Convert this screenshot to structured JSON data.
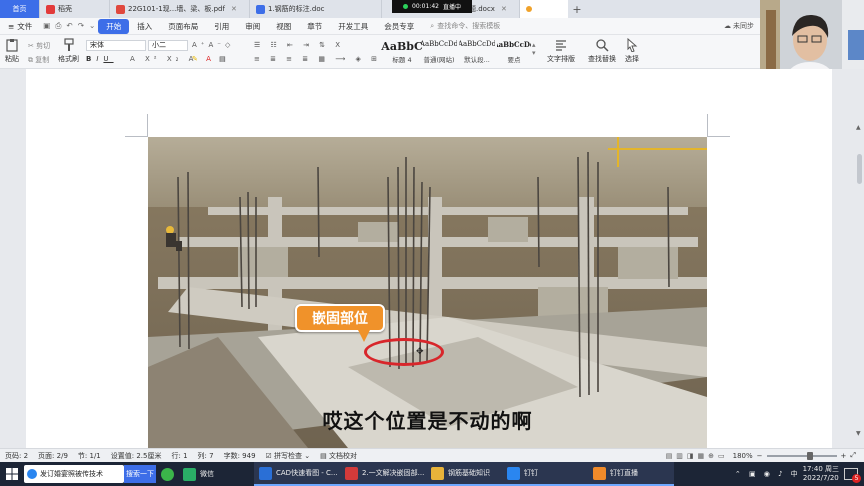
{
  "tabs": [
    {
      "label": "首页",
      "kind": "home"
    },
    {
      "label": "稻壳",
      "kind": "app"
    },
    {
      "label": "22G101-1现...墙、梁、板.pdf",
      "kind": "pdf"
    },
    {
      "label": "1.钢筋的标注.doc",
      "kind": "doc"
    },
    {
      "label": "问题.docx",
      "kind": "doc"
    }
  ],
  "live": {
    "time": "00:01:42",
    "label": "直播中"
  },
  "menu": {
    "file": "文件",
    "items": [
      "开始",
      "插入",
      "页面布局",
      "引用",
      "审阅",
      "视图",
      "章节",
      "开发工具",
      "会员专享"
    ],
    "search_placeholder": "查找命令、搜索模板",
    "cloud": "未同步"
  },
  "ribbon": {
    "paste": "粘贴",
    "cut": "剪切",
    "copy": "复制",
    "format_painter": "格式刷",
    "font_name": "宋体",
    "font_size": "小二",
    "styles": [
      {
        "sample": "AaBbC",
        "name": "标题 4"
      },
      {
        "sample": "AaBbCcDd",
        "name": "普通(网站)"
      },
      {
        "sample": "AaBbCcDd",
        "name": "默认段..."
      },
      {
        "sample": "AaBbCcDd",
        "name": "要点"
      }
    ],
    "text_layout": "文字排版",
    "find_replace": "查找替换",
    "select": "选择"
  },
  "document": {
    "callout": "嵌固部位",
    "subtitle": "哎这个位置是不动的啊"
  },
  "status": {
    "page_code": "页码: 2",
    "pages": "页面: 2/9",
    "section": "节: 1/1",
    "setting": "设置值: 2.5厘米",
    "row": "行: 1",
    "col": "列: 7",
    "words": "字数: 949",
    "spell": "拼写检查",
    "proof": "文档校对",
    "zoom": "180%"
  },
  "taskbar": {
    "browser_tab": "发订婚宴照被传技术",
    "search_btn": "搜索一下",
    "apps": [
      {
        "label": "微信",
        "color": "#2aae67"
      },
      {
        "label": "CAD快速看图 - C...",
        "color": "#2a6fd6"
      },
      {
        "label": "2.一文解决嵌固部...",
        "color": "#d23a3a"
      },
      {
        "label": "钢筋基础知识",
        "color": "#e8b33a"
      },
      {
        "label": "钉钉",
        "color": "#2a86f0"
      },
      {
        "label": "钉钉直播",
        "color": "#f08a2a"
      }
    ],
    "time": "17:40 周三",
    "date": "2022/7/20",
    "ime": "中",
    "notif_count": "5"
  },
  "colors": {
    "accent": "#3d6ee8",
    "callout": "#f0922a",
    "ring": "#d8262b",
    "taskbar": "#1c2536"
  }
}
